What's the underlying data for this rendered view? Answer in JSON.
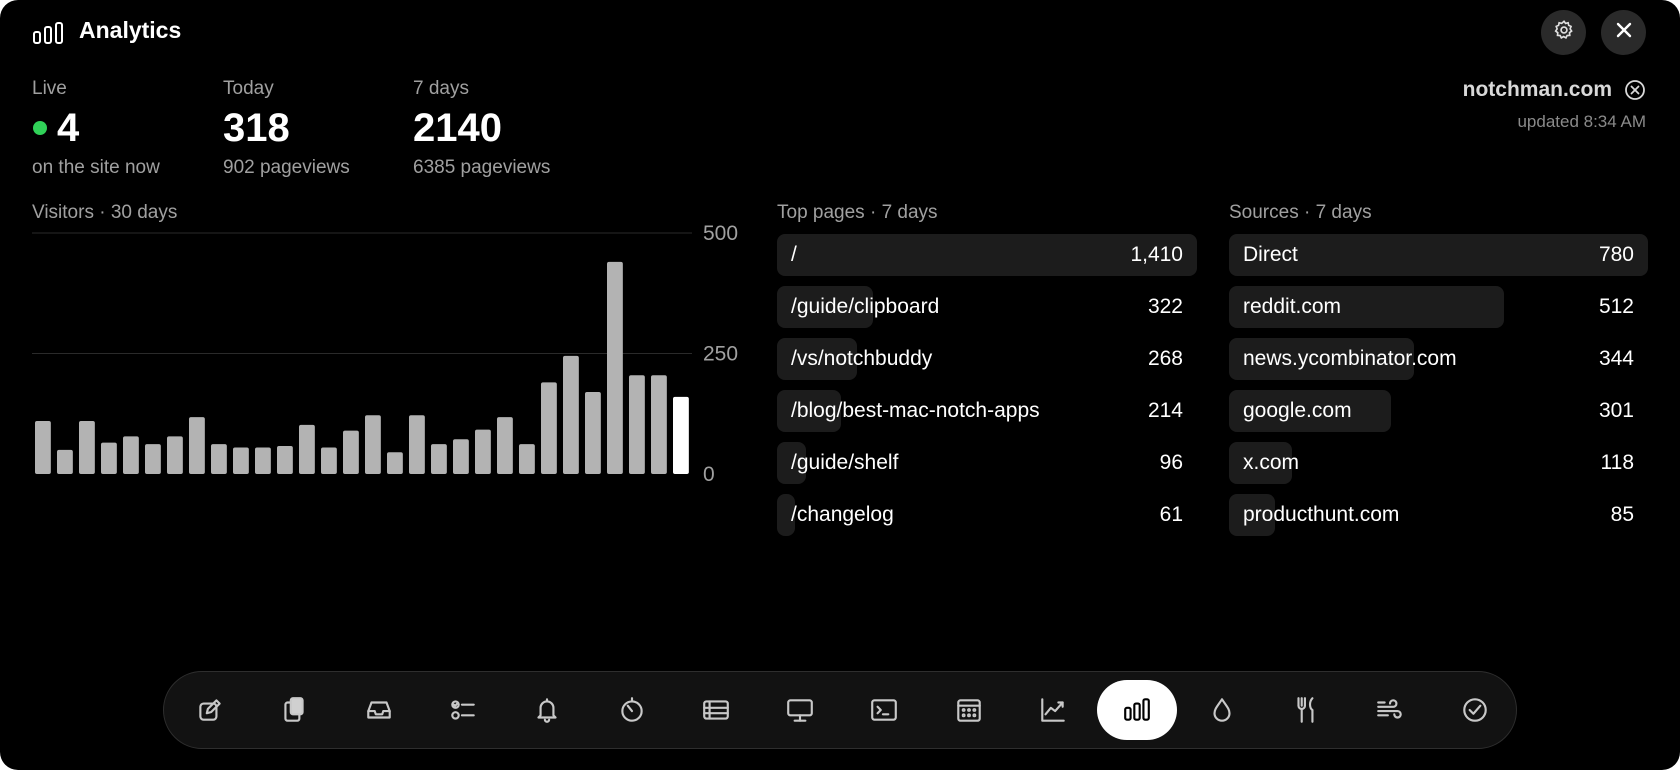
{
  "header": {
    "title": "Analytics",
    "title_icon": "bar-chart-icon",
    "settings_icon": "gear-icon",
    "close_icon": "close-icon"
  },
  "stats": {
    "live": {
      "label": "Live",
      "value": "4",
      "sub": "on the site now",
      "indicator_color": "#30d158"
    },
    "today": {
      "label": "Today",
      "value": "318",
      "sub": "902 pageviews"
    },
    "week": {
      "label": "7 days",
      "value": "2140",
      "sub": "6385 pageviews"
    }
  },
  "site": {
    "name": "notchman.com",
    "updated": "updated 8:34 AM",
    "clear_icon": "clear-circle-icon"
  },
  "visitors_title": "Visitors · 30 days",
  "chart_data": {
    "type": "bar",
    "title": "Visitors · 30 days",
    "yticks": [
      "500",
      "250",
      "0"
    ],
    "ylim": [
      0,
      500
    ],
    "grid": true,
    "values": [
      110,
      50,
      110,
      65,
      78,
      62,
      78,
      118,
      62,
      55,
      55,
      58,
      102,
      55,
      90,
      122,
      45,
      122,
      62,
      72,
      92,
      118,
      62,
      190,
      245,
      170,
      440,
      205,
      205,
      160
    ],
    "colors": {
      "bars": "#b3b3b3",
      "last_bar": "#ffffff",
      "grid": "#2a2a2a"
    }
  },
  "top_pages": {
    "title": "Top pages · 7 days",
    "rows": [
      {
        "label": "/",
        "value": "1,410",
        "n": 1410
      },
      {
        "label": "/guide/clipboard",
        "value": "322",
        "n": 322
      },
      {
        "label": "/vs/notchbuddy",
        "value": "268",
        "n": 268
      },
      {
        "label": "/blog/best-mac-notch-apps",
        "value": "214",
        "n": 214
      },
      {
        "label": "/guide/shelf",
        "value": "96",
        "n": 96
      },
      {
        "label": "/changelog",
        "value": "61",
        "n": 61
      }
    ]
  },
  "sources": {
    "title": "Sources · 7 days",
    "rows": [
      {
        "label": "Direct",
        "value": "780",
        "n": 780
      },
      {
        "label": "reddit.com",
        "value": "512",
        "n": 512
      },
      {
        "label": "news.ycombinator.com",
        "value": "344",
        "n": 344
      },
      {
        "label": "google.com",
        "value": "301",
        "n": 301
      },
      {
        "label": "x.com",
        "value": "118",
        "n": 118
      },
      {
        "label": "producthunt.com",
        "value": "85",
        "n": 85
      }
    ]
  },
  "dock": {
    "items": [
      {
        "icon": "compose-icon"
      },
      {
        "icon": "clipboard-icon"
      },
      {
        "icon": "tray-icon"
      },
      {
        "icon": "checklist-icon"
      },
      {
        "icon": "bell-icon"
      },
      {
        "icon": "timer-icon"
      },
      {
        "icon": "list-icon"
      },
      {
        "icon": "display-icon"
      },
      {
        "icon": "terminal-icon"
      },
      {
        "icon": "calendar-icon"
      },
      {
        "icon": "stocks-icon"
      },
      {
        "icon": "analytics-icon",
        "active": true
      },
      {
        "icon": "water-drop-icon"
      },
      {
        "icon": "fork-knife-icon"
      },
      {
        "icon": "wind-icon"
      },
      {
        "icon": "checkmark-circle-icon"
      }
    ]
  }
}
